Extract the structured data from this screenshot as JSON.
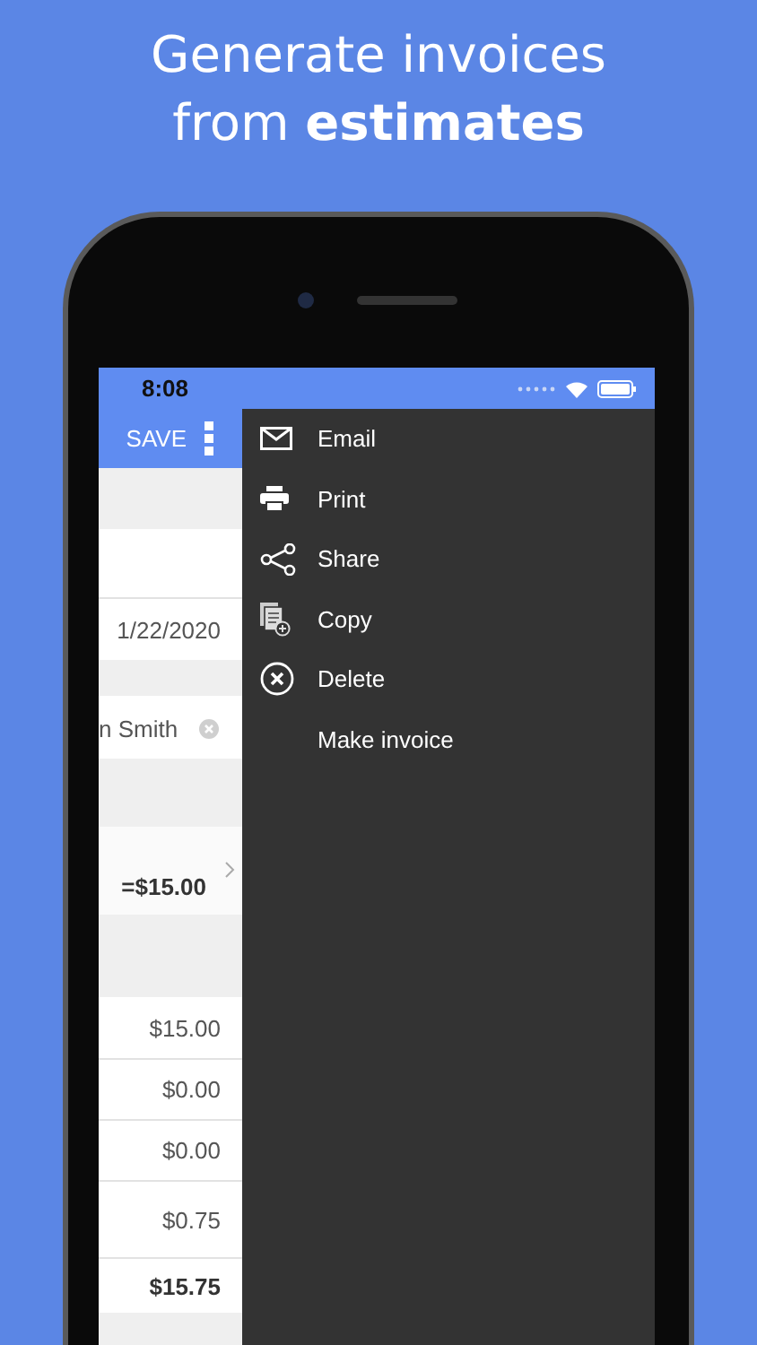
{
  "headline_lines": [
    "Generate invoices",
    "from **estimates**"
  ],
  "status_bar": {
    "time": "8:08"
  },
  "app_bar": {
    "save_label": "SAVE"
  },
  "form": {
    "date": "1/22/2020",
    "client": "n Smith",
    "item_total": "=$15.00",
    "amounts": [
      "$15.00",
      "$0.00",
      "$0.00",
      "$0.75"
    ],
    "total": "$15.75"
  },
  "menu": {
    "items": [
      {
        "label": "Email"
      },
      {
        "label": "Print"
      },
      {
        "label": "Share"
      },
      {
        "label": "Copy"
      },
      {
        "label": "Delete"
      },
      {
        "label": "Make invoice"
      }
    ]
  }
}
